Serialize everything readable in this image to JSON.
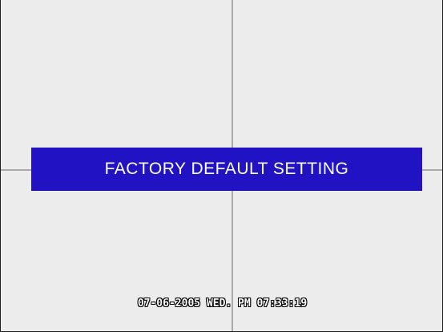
{
  "screen": {
    "background_color": "#ececec",
    "grid_line_color": "#a9a9a9"
  },
  "banner": {
    "message": "FACTORY DEFAULT SETTING",
    "background_color": "#2112c4",
    "text_color": "#ffffff"
  },
  "status": {
    "timestamp": "07-06-2005 WED. PM 07:33:19"
  }
}
